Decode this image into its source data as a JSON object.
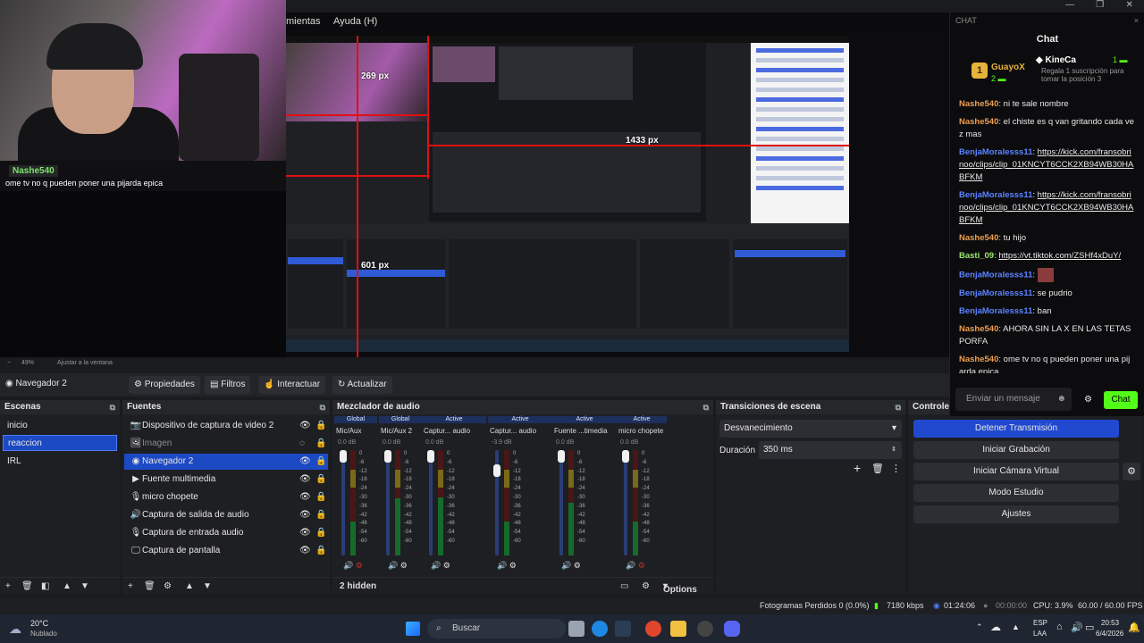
{
  "menu": {
    "items": [
      "mientas",
      "Ayuda (H)"
    ]
  },
  "window_controls": [
    "—",
    "❐",
    "✕"
  ],
  "webcam_overlay": {
    "user": "Nashe540",
    "message": "ome tv no q pueden poner una pijarda epica"
  },
  "preview_labels": {
    "px1": "269 px",
    "px2": "1433 px",
    "px3": "601 px"
  },
  "zoom": {
    "value": "49%",
    "mode": "Ajustar a la ventana"
  },
  "toolbar": {
    "source_name": "Navegador 2",
    "properties": "Propiedades",
    "filters": "Filtros",
    "interact": "Interactuar",
    "refresh": "Actualizar"
  },
  "scenes": {
    "title": "Escenas",
    "items": [
      "inicio",
      "reaccion",
      "IRL"
    ],
    "selected": 1
  },
  "sources": {
    "title": "Fuentes",
    "items": [
      {
        "name": "Dispositivo de captura de video 2",
        "icon": "camera-icon"
      },
      {
        "name": "Imagen",
        "icon": "image-icon"
      },
      {
        "name": "Navegador 2",
        "icon": "globe-icon"
      },
      {
        "name": "Fuente multimedia",
        "icon": "play-icon"
      },
      {
        "name": "micro chopete",
        "icon": "mic-icon"
      },
      {
        "name": "Captura de salida de audio",
        "icon": "speaker-icon"
      },
      {
        "name": "Captura de entrada audio",
        "icon": "mic-icon"
      },
      {
        "name": "Captura de pantalla",
        "icon": "monitor-icon"
      }
    ]
  },
  "mixer": {
    "title": "Mezclador de audio",
    "channels": [
      {
        "status": "Global",
        "name": "Mic/Aux",
        "db": "0.0 dB",
        "level": 0.0
      },
      {
        "status": "Global",
        "name": "Mic/Aux 2",
        "db": "0.0 dB",
        "level": 0.68
      },
      {
        "status": "Active",
        "name": "Captur... audio",
        "db": "0.0 dB",
        "level": 0.72
      },
      {
        "status": "Active",
        "name": "Captur... audio",
        "db": "-3.9 dB",
        "level": 0.0
      },
      {
        "status": "Active",
        "name": "Fuente ...timedia",
        "db": "0.0 dB",
        "level": 0.55
      },
      {
        "status": "Active",
        "name": "micro chopete",
        "db": "0.0 dB",
        "level": 0.0
      }
    ],
    "ticks": [
      "0",
      "-6",
      "-12",
      "-18",
      "-24",
      "-30",
      "-36",
      "-42",
      "-48",
      "-54",
      "-60"
    ],
    "hidden": "2 hidden",
    "options": "Options"
  },
  "transitions": {
    "title": "Transiciones de escena",
    "selected": "Desvanecimiento",
    "duration_label": "Duración",
    "duration": "350 ms"
  },
  "controls": {
    "title": "Controles",
    "stream": "Detener Transmisión",
    "record": "Iniciar Grabación",
    "virtualcam": "Iniciar Cámara Virtual",
    "studio": "Modo Estudio",
    "settings": "Ajustes"
  },
  "chat": {
    "window_title": "CHAT",
    "title": "Chat",
    "leaderboard": [
      {
        "name": "GuayoX",
        "count": "2"
      },
      {
        "name": "KineCa",
        "count": "1",
        "note": "Regala 1 suscripción para tomar la posición 3"
      }
    ],
    "messages": [
      {
        "user": "Nashe540",
        "text": "ni te sale nombre",
        "color": "orange"
      },
      {
        "user": "Nashe540",
        "text": "el chiste es q van gritando cada vez mas",
        "color": "orange"
      },
      {
        "user": "BenjaMoralesss11",
        "text": "https://kick.com/fransobrinoo/clips/clip_01KNCYT6CCK2XB94WB30HABFKM",
        "color": "blue",
        "link": true
      },
      {
        "user": "BenjaMoralesss11",
        "text": "https://kick.com/fransobrinoo/clips/clip_01KNCYT6CCK2XB94WB30HABFKM",
        "color": "blue",
        "link": true
      },
      {
        "user": "Nashe540",
        "text": "tu hijo",
        "color": "orange"
      },
      {
        "user": "Basti_09",
        "text": "https://vt.tiktok.com/ZSHf4xDuY/",
        "color": "green",
        "link": true
      },
      {
        "user": "BenjaMoralesss11",
        "text": "",
        "color": "blue"
      },
      {
        "user": "BenjaMoralesss11",
        "text": "se pudrio",
        "color": "blue"
      },
      {
        "user": "BenjaMoralesss11",
        "text": "ban",
        "color": "blue"
      },
      {
        "user": "Nashe540",
        "text": "AHORA SIN LA X EN LAS TETAS PORFA",
        "color": "orange"
      },
      {
        "user": "Nashe540",
        "text": "ome tv no q pueden poner una pijarda epica",
        "color": "orange"
      }
    ],
    "input_placeholder": "Enviar un mensaje",
    "send": "Chat"
  },
  "status": {
    "dropped": "Fotogramas Perdidos 0 (0.0%)",
    "bitrate": "7180 kbps",
    "live_time": "01:24:06",
    "rec_time": "00:00:00",
    "cpu": "CPU: 3.9%",
    "fps": "60.00 / 60.00 FPS"
  },
  "taskbar": {
    "weather_temp": "20°C",
    "weather_desc": "Nublado",
    "search": "Buscar",
    "lang": "ESP",
    "lang2": "LAA",
    "time": "20:53",
    "date": "6/4/2026"
  }
}
